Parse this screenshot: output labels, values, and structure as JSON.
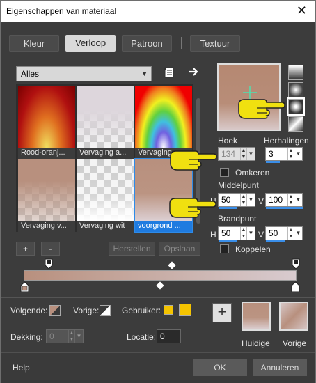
{
  "window": {
    "title": "Eigenschappen van materiaal"
  },
  "tabs": [
    {
      "label": "Kleur",
      "active": false
    },
    {
      "label": "Verloop",
      "active": true
    },
    {
      "label": "Patroon",
      "active": false
    },
    {
      "label": "Textuur",
      "active": false
    }
  ],
  "category": {
    "value": "Alles"
  },
  "gradients": [
    {
      "label": "Rood-oranj..."
    },
    {
      "label": "Vervaging a..."
    },
    {
      "label": "Vervaging ..."
    },
    {
      "label": "Vervaging v..."
    },
    {
      "label": "Vervaging wit"
    },
    {
      "label": "voorgrond ...",
      "selected": true
    }
  ],
  "buttons": {
    "add": "+",
    "remove": "-",
    "reset": "Herstellen",
    "save": "Opslaan",
    "ok": "OK",
    "cancel": "Annuleren",
    "help": "Help",
    "plus": "+"
  },
  "angle": {
    "label": "Hoek",
    "value": "134"
  },
  "repeats": {
    "label": "Herhalingen",
    "value": "3"
  },
  "invert": {
    "label": "Omkeren",
    "checked": false
  },
  "center": {
    "label": "Middelpunt",
    "h_label": "H",
    "h": "50",
    "v_label": "V",
    "v": "100"
  },
  "focal": {
    "label": "Brandpunt",
    "h_label": "H",
    "h": "50",
    "v_label": "V",
    "v": "50"
  },
  "link": {
    "label": "Koppelen",
    "checked": false
  },
  "stops": {
    "next_label": "Volgende:",
    "prev_label": "Vorige:",
    "user_label": "Gebruiker:",
    "opacity_label": "Dekking:",
    "opacity_value": "0",
    "location_label": "Locatie:",
    "location_value": "0",
    "user_color": "#f5c400"
  },
  "swatches": {
    "current_label": "Huidige",
    "previous_label": "Vorige"
  },
  "colors": {
    "accent": "#2e8be8",
    "start": "#b8907e",
    "end": "#d8cbcf"
  },
  "icons": [
    "list-icon",
    "arrow-right-icon",
    "close-icon",
    "pointing-hand-icon"
  ]
}
